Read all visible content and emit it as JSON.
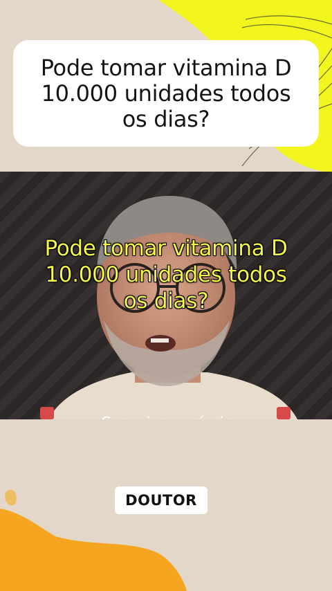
{
  "question": {
    "line1": "Pode tomar vitamina D",
    "line2": "10.000 unidades todos",
    "line3": "os dias?"
  },
  "video": {
    "caption_line1": "Pode tomar vitamina D",
    "caption_line2": "10.000 unidades todos",
    "caption_line3": "os dias?",
    "subtitle_partial": "Casos irreversíveis"
  },
  "badge": {
    "label": "DOUTOR"
  },
  "colors": {
    "background": "#e2d7c8",
    "accent_yellow": "#f2f61e",
    "accent_orange": "#f5a51f",
    "caption_yellow": "#f4f84a",
    "card": "#ffffff"
  }
}
